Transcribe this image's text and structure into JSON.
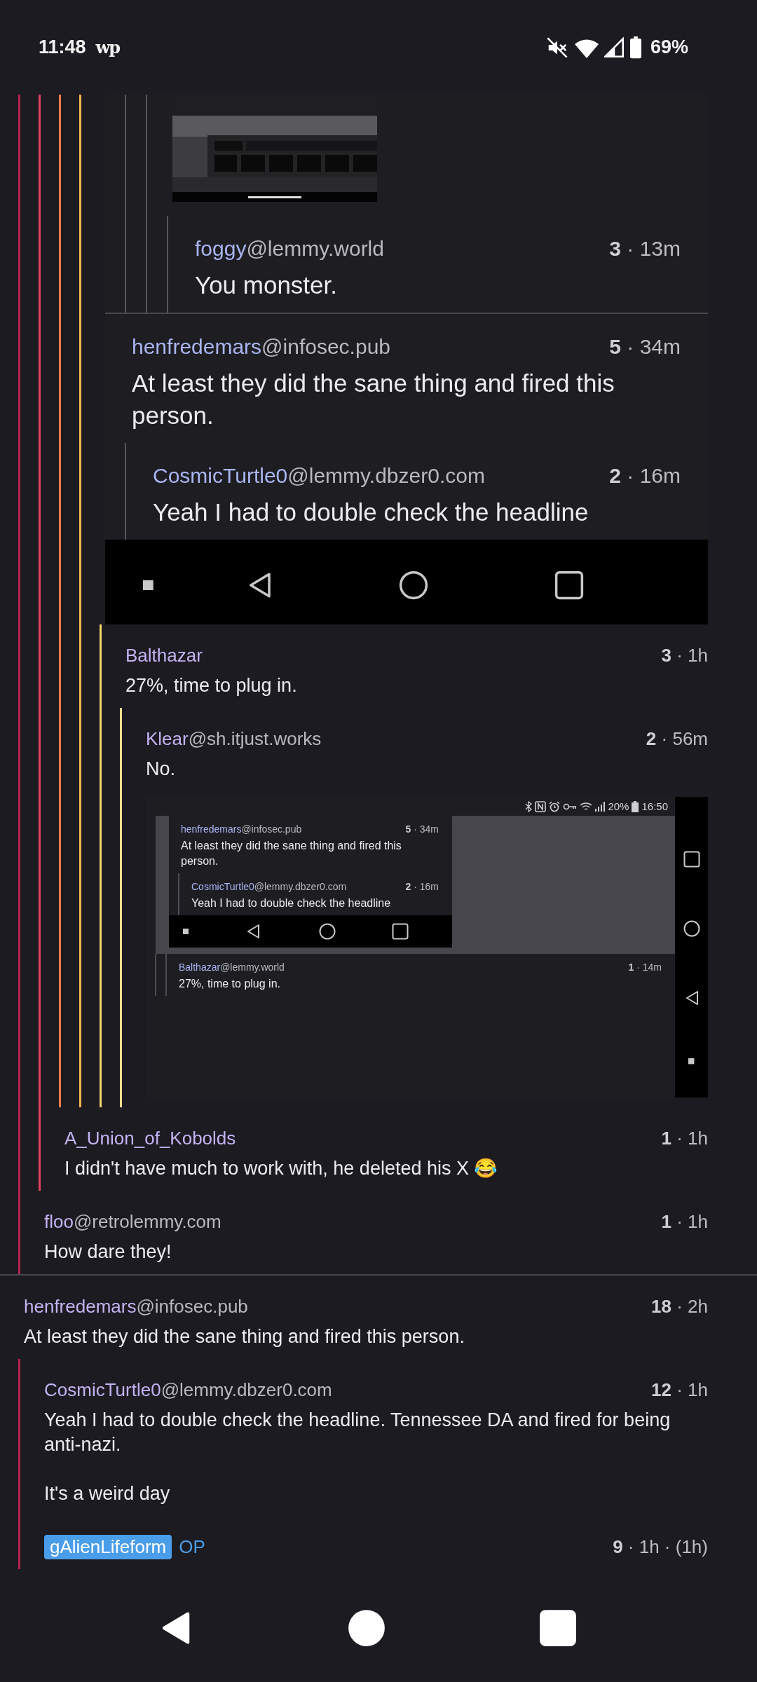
{
  "status_bar": {
    "time": "11:48",
    "logo": "wp",
    "battery": "69%"
  },
  "thread": [
    {
      "kind": "branch",
      "children": [
        {
          "kind": "branch",
          "children": [
            {
              "kind": "branch",
              "children": [
                {
                  "kind": "branch",
                  "children": [
                    {
                      "kind": "screenshot",
                      "comments": [
                        {
                          "kind": "branch",
                          "children": [
                            {
                              "kind": "branch",
                              "children": [
                                {
                                  "kind": "picture"
                                },
                                {
                                  "kind": "branch",
                                  "children": [
                                    {
                                      "kind": "comment",
                                      "user": "foggy",
                                      "instance": "@lemmy.world",
                                      "score": "3",
                                      "age": "· 13m",
                                      "paragraphs": [
                                        "You monster."
                                      ]
                                    }
                                  ]
                                }
                              ]
                            }
                          ]
                        },
                        {
                          "kind": "comment",
                          "user": "henfredemars",
                          "instance": "@infosec.pub",
                          "score": "5",
                          "age": "· 34m",
                          "paragraphs": [
                            "At least they did the sane thing and fired this person."
                          ],
                          "children": [
                            {
                              "kind": "comment",
                              "user": "CosmicTurtle0",
                              "instance": "@lemmy.dbzer0.com",
                              "score": "2",
                              "age": "· 16m",
                              "paragraphs": [
                                "Yeah I had to double check the headline"
                              ]
                            }
                          ]
                        }
                      ]
                    },
                    {
                      "kind": "branch",
                      "children": [
                        {
                          "kind": "comment",
                          "user": "Balthazar",
                          "score": "3",
                          "age": "· 1h",
                          "paragraphs": [
                            "27%, time to plug in."
                          ],
                          "children": [
                            {
                              "kind": "comment",
                              "user": "Klear",
                              "instance": "@sh.itjust.works",
                              "score": "2",
                              "age": "· 56m",
                              "paragraphs": [
                                "No."
                              ],
                              "screenshot": {
                                "battery": "20%",
                                "time": "16:50",
                                "inner_comments": [
                                  {
                                    "kind": "comment",
                                    "user": "henfredemars",
                                    "instance": "@infosec.pub",
                                    "score": "5",
                                    "age": "· 34m",
                                    "paragraphs": [
                                      "At least they did the sane thing and fired this person."
                                    ],
                                    "children": [
                                      {
                                        "kind": "comment",
                                        "user": "CosmicTurtle0",
                                        "instance": "@lemmy.dbzer0.com",
                                        "score": "2",
                                        "age": "· 16m",
                                        "paragraphs": [
                                          "Yeah I had to double check the headline"
                                        ]
                                      }
                                    ]
                                  }
                                ],
                                "comments": [
                                  {
                                    "kind": "branch",
                                    "children": [
                                      {
                                        "kind": "branch",
                                        "children": [
                                          {
                                            "kind": "comment",
                                            "user": "Balthazar",
                                            "instance": "@lemmy.world",
                                            "score": "1",
                                            "age": "· 14m",
                                            "paragraphs": [
                                              "27%, time to plug in."
                                            ]
                                          }
                                        ]
                                      }
                                    ]
                                  }
                                ]
                              }
                            }
                          ]
                        }
                      ]
                    }
                  ]
                }
              ]
            },
            {
              "kind": "comment",
              "user": "A_Union_of_Kobolds",
              "score": "1",
              "age": "· 1h",
              "paragraphs": [
                "I didn't have much to work with, he deleted his X 😂"
              ]
            }
          ]
        },
        {
          "kind": "comment",
          "user": "floo",
          "instance": "@retrolemmy.com",
          "score": "1",
          "age": "· 1h",
          "paragraphs": [
            "How dare they!"
          ]
        }
      ]
    },
    {
      "kind": "comment",
      "user": "henfredemars",
      "instance": "@infosec.pub",
      "score": "18",
      "age": "· 2h",
      "paragraphs": [
        "At least they did the sane thing and fired this person."
      ],
      "children": [
        {
          "kind": "comment",
          "user": "CosmicTurtle0",
          "instance": "@lemmy.dbzer0.com",
          "score": "12",
          "age": "· 1h",
          "paragraphs": [
            "Yeah I had to double check the headline. Tennessee DA and fired for being anti-nazi.",
            "It's a weird day"
          ]
        },
        {
          "kind": "comment",
          "user": "gAlienLifeform",
          "highlighted": true,
          "badge": "OP",
          "score": "9",
          "age": "· 1h · (1h)"
        }
      ]
    }
  ]
}
